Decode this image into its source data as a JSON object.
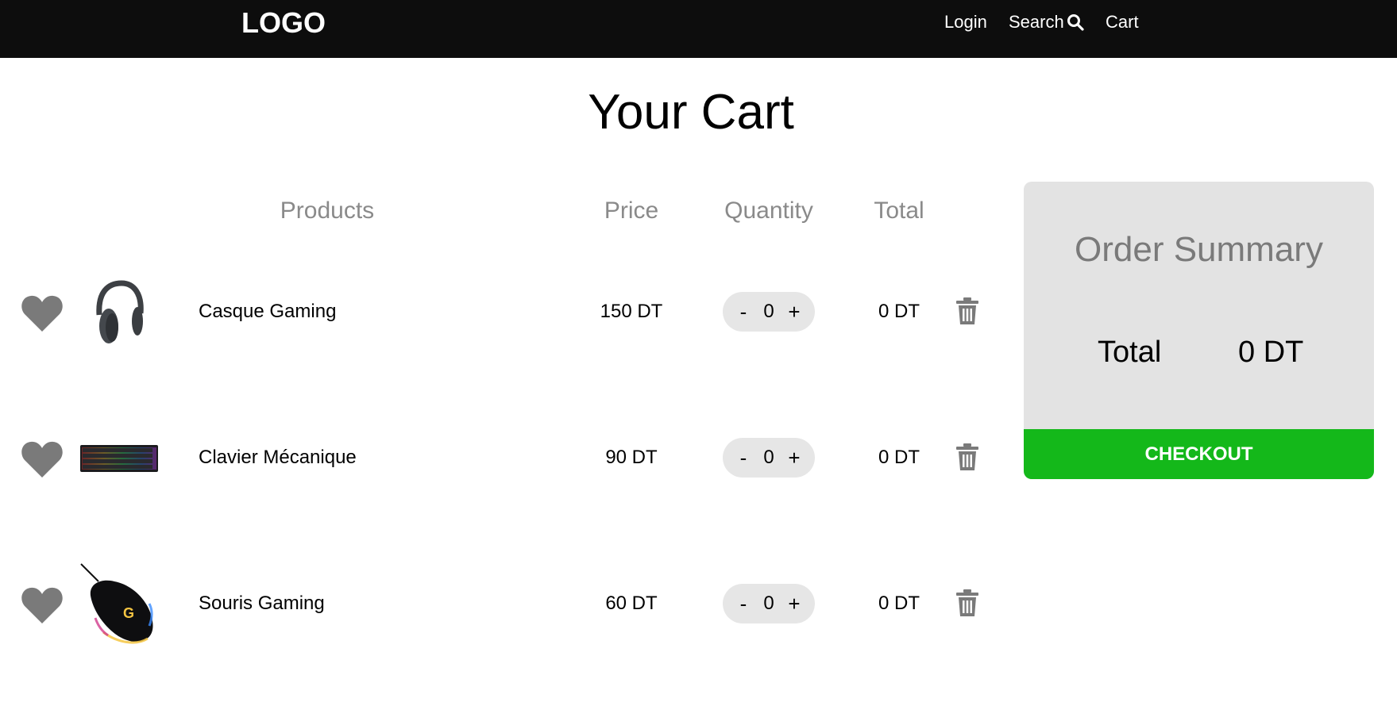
{
  "nav": {
    "logo": "LOGO",
    "login": "Login",
    "search": "Search",
    "cart": "Cart"
  },
  "page": {
    "title": "Your Cart"
  },
  "table": {
    "headers": {
      "products": "Products",
      "price": "Price",
      "quantity": "Quantity",
      "total": "Total"
    },
    "rows": [
      {
        "name": "Casque Gaming",
        "price": "150 DT",
        "quantity": "0",
        "total": "0 DT"
      },
      {
        "name": "Clavier Mécanique",
        "price": "90 DT",
        "quantity": "0",
        "total": "0 DT"
      },
      {
        "name": "Souris Gaming",
        "price": "60 DT",
        "quantity": "0",
        "total": "0 DT"
      }
    ],
    "decrement_label": "-",
    "increment_label": "+"
  },
  "summary": {
    "title": "Order Summary",
    "total_label": "Total",
    "total_value": "0 DT",
    "checkout_label": "CHECKOUT"
  },
  "colors": {
    "navbar": "#0d0d0d",
    "accent_checkout": "#14b81a",
    "summary_bg": "#e3e3e3",
    "muted_text": "#8a8a8a",
    "icon_gray": "#7a7a7a"
  },
  "icons": {
    "search": "magnifier-icon",
    "wishlist": "heart-icon",
    "remove": "trash-icon"
  }
}
